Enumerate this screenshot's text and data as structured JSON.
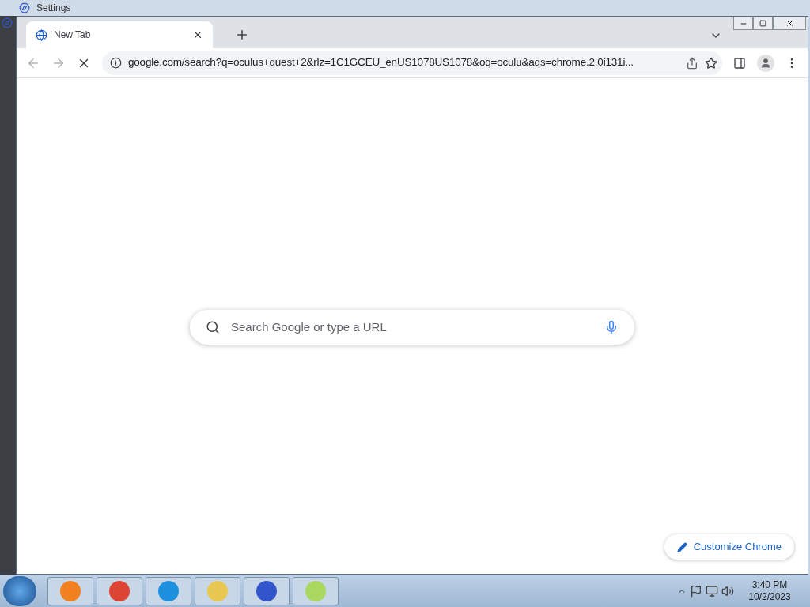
{
  "background_window": {
    "title": "Settings"
  },
  "browser": {
    "tabs": [
      {
        "title": "New Tab",
        "selected": true
      }
    ],
    "loading": true,
    "address": "google.com/search?q=oculus+quest+2&rlz=1C1GCEU_enUS1078US1078&oq=oculu&aqs=chrome.2.0i131i...",
    "search": {
      "placeholder": "Search Google or type a URL"
    },
    "customize_button": "Customize Chrome"
  },
  "taskbar": {
    "time": "3:40 PM",
    "date": "10/2/2023"
  }
}
